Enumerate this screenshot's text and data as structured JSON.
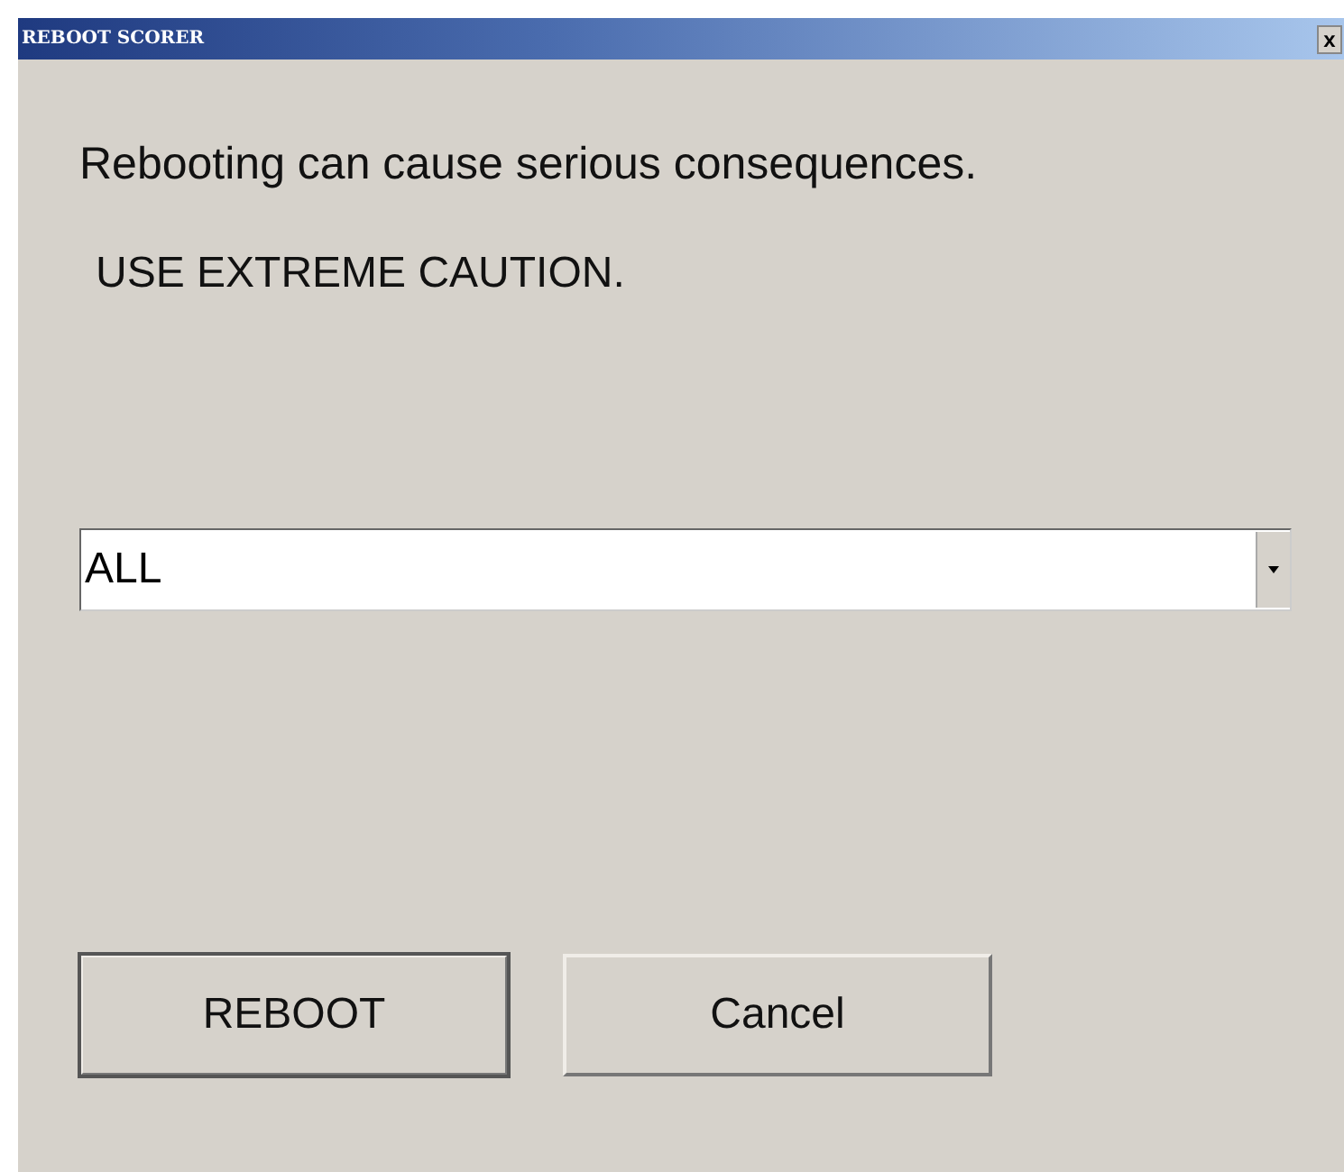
{
  "window": {
    "title": "REBOOT SCORER",
    "close": "x"
  },
  "message": "Rebooting can cause serious consequences.",
  "warning": "USE EXTREME CAUTION.",
  "dropdown": {
    "value": "ALL"
  },
  "buttons": [
    {
      "label": "REBOOT",
      "default": true
    },
    {
      "label": "Cancel",
      "default": false
    }
  ]
}
